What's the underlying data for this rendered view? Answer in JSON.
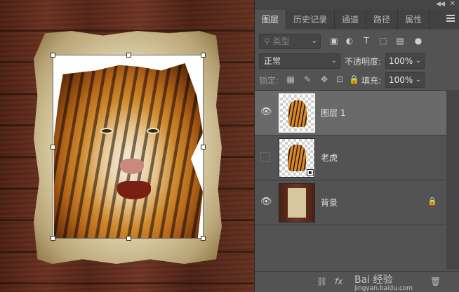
{
  "tabs": [
    "图层",
    "历史记录",
    "通道",
    "路径",
    "属性"
  ],
  "filter": {
    "placeholder": "类型"
  },
  "blend": {
    "mode": "正常",
    "opacity_label": "不透明度:",
    "opacity_value": "100%"
  },
  "lock": {
    "label": "锁定:",
    "fill_label": "填充:",
    "fill_value": "100%"
  },
  "layers": [
    {
      "name": "图层 1",
      "visible": true,
      "selected": true
    },
    {
      "name": "老虎",
      "visible": false,
      "selected": false
    },
    {
      "name": "背景",
      "visible": true,
      "selected": false,
      "locked": true
    }
  ],
  "watermark": {
    "text": "Bai 经验",
    "url": "jingyan.baidu.com"
  },
  "icons": {
    "eye": "eye-icon",
    "lock": "lock-icon",
    "menu": "menu-icon"
  }
}
